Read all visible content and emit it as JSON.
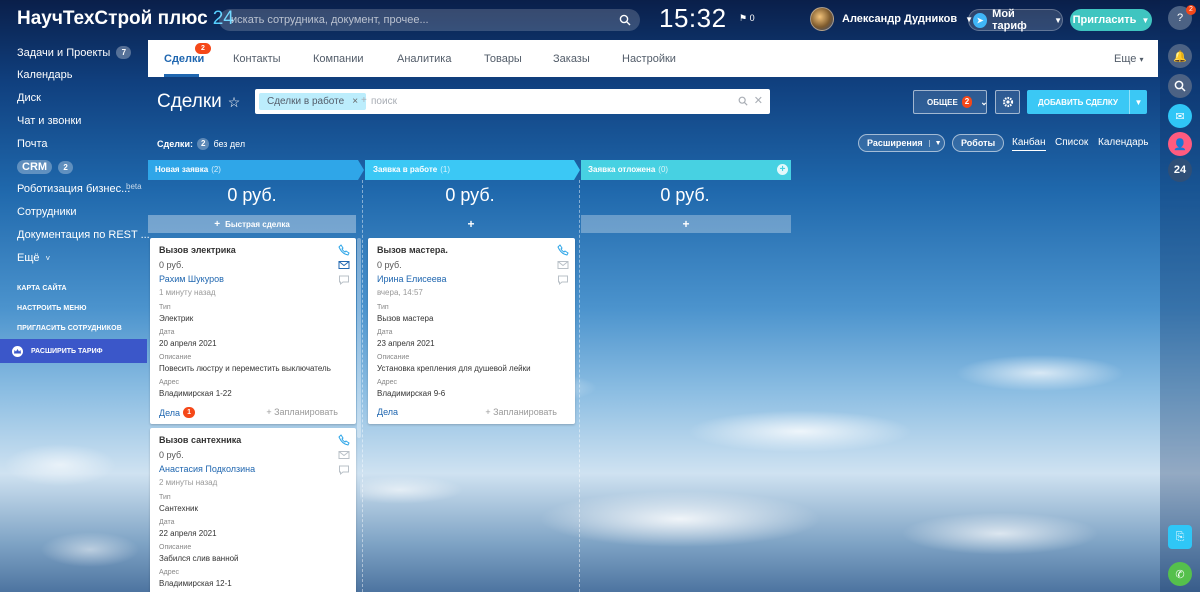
{
  "app": {
    "title_main": "НаучТехСтрой плюс",
    "title_num": "24"
  },
  "header": {
    "search_placeholder": "искать сотрудника, документ, прочее...",
    "clock": "15:32",
    "flag_count": "0",
    "user_name": "Александр Дудников",
    "tariff_label": "Мой тариф",
    "invite_label": "Пригласить"
  },
  "left_menu": {
    "items": [
      {
        "label": "Задачи и Проекты",
        "count": "7"
      },
      {
        "label": "Календарь"
      },
      {
        "label": "Диск"
      },
      {
        "label": "Чат и звонки"
      },
      {
        "label": "Почта"
      },
      {
        "label": "CRM",
        "count": "2"
      },
      {
        "label": "Роботизация бизнес..."
      },
      {
        "label": "Сотрудники"
      },
      {
        "label": "Документация по REST ..."
      },
      {
        "label": "Ещё"
      }
    ],
    "beta_label": "beta",
    "more_caret": "˅",
    "links": [
      "КАРТА САЙТА",
      "НАСТРОИТЬ МЕНЮ",
      "ПРИГЛАСИТЬ СОТРУДНИКОВ"
    ],
    "upgrade_label": "РАСШИРИТЬ ТАРИФ"
  },
  "tabs": {
    "items": [
      "Сделки",
      "Контакты",
      "Компании",
      "Аналитика",
      "Товары",
      "Заказы",
      "Настройки"
    ],
    "active_badge": "2",
    "more_label": "Еще"
  },
  "page": {
    "title": "Сделки",
    "filter_chip": "Сделки в работе",
    "filter_plus": "+",
    "filter_placeholder": "поиск",
    "general_label": "ОБЩЕЕ",
    "general_badge": "2",
    "add_deal_label": "ДОБАВИТЬ СДЕЛКУ",
    "deals_label": "Сделки:",
    "deals_count": "2",
    "deals_suffix": "без дел",
    "extensions_label": "Расширения",
    "robots_label": "Роботы",
    "views": [
      "Канбан",
      "Список",
      "Календарь"
    ]
  },
  "kanban": {
    "columns": [
      {
        "name": "Новая заявка",
        "count": "(2)",
        "sum": "0 руб.",
        "quick": "Быстрая сделка",
        "color": "#2fa6e8"
      },
      {
        "name": "Заявка в работе",
        "count": "(1)",
        "sum": "0 руб.",
        "quick": "",
        "color": "#3bc8f5"
      },
      {
        "name": "Заявка отложена",
        "count": "(0)",
        "sum": "0 руб.",
        "quick": "",
        "color": "#47d1e2"
      }
    ],
    "labels": {
      "type": "Тип",
      "date": "Дата",
      "desc": "Описание",
      "address": "Адрес",
      "deals": "Дела",
      "plan": "+ Запланировать"
    },
    "cards": [
      {
        "title": "Вызов электрика",
        "sum": "0 руб.",
        "person": "Рахим Шукуров",
        "time": "1 минуту назад",
        "type": "Электрик",
        "date": "20 апреля 2021",
        "desc": "Повесить люстру и переместить выключатель",
        "address": "Владимирская 1-22",
        "deals_badge": "1"
      },
      {
        "title": "Вызов сантехника",
        "sum": "0 руб.",
        "person": "Анастасия Подколзина",
        "time": "2 минуты назад",
        "type": "Сантехник",
        "date": "22 апреля 2021",
        "desc": "Забился слив ванной",
        "address": "Владимирская 12-1"
      },
      {
        "title": "Вызов мастера.",
        "sum": "0 руб.",
        "person": "Ирина Елисеева",
        "time": "вчера, 14:57",
        "type": "Вызов мастера",
        "date": "23 апреля 2021",
        "desc": "Установка крепления для душевой лейки",
        "address": "Владимирская 9-6"
      }
    ]
  },
  "right_panel": {
    "help_badge": "2",
    "counter_label": "24"
  }
}
